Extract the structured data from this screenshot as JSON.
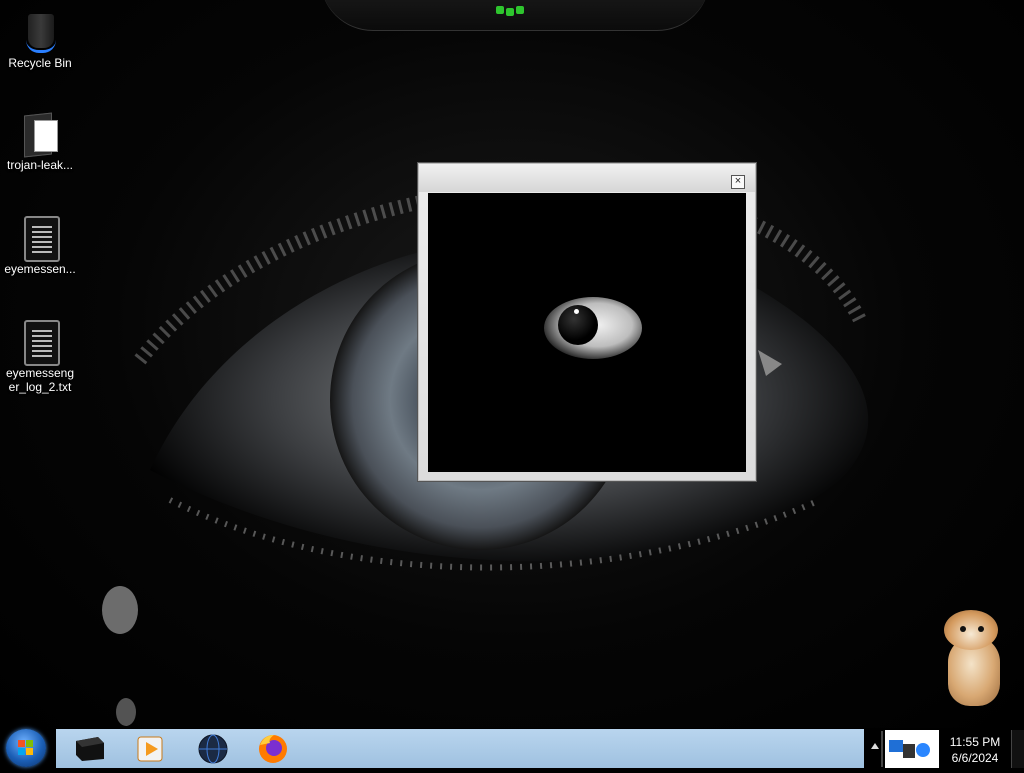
{
  "desktop": {
    "icons": [
      {
        "label": "Recycle Bin"
      },
      {
        "label": "trojan-leak..."
      },
      {
        "label": "eyemessen..."
      },
      {
        "label": "eyemessenger_log_2.txt"
      }
    ]
  },
  "popup": {
    "close_icon": "close-icon"
  },
  "taskbar": {
    "start_icon": "windows-start-icon",
    "pinned": [
      "black-box-icon",
      "media-player-icon",
      "globe-icon",
      "firefox-icon"
    ],
    "tray_arrow": "show-hidden-icons-icon",
    "clock": {
      "time": "11:55 PM",
      "date": "6/6/2024"
    }
  },
  "colors": {
    "taskbar_bg": "#b9d5ee",
    "start_orb": "#1b5fb6",
    "notch_led": "#2ec52e"
  }
}
